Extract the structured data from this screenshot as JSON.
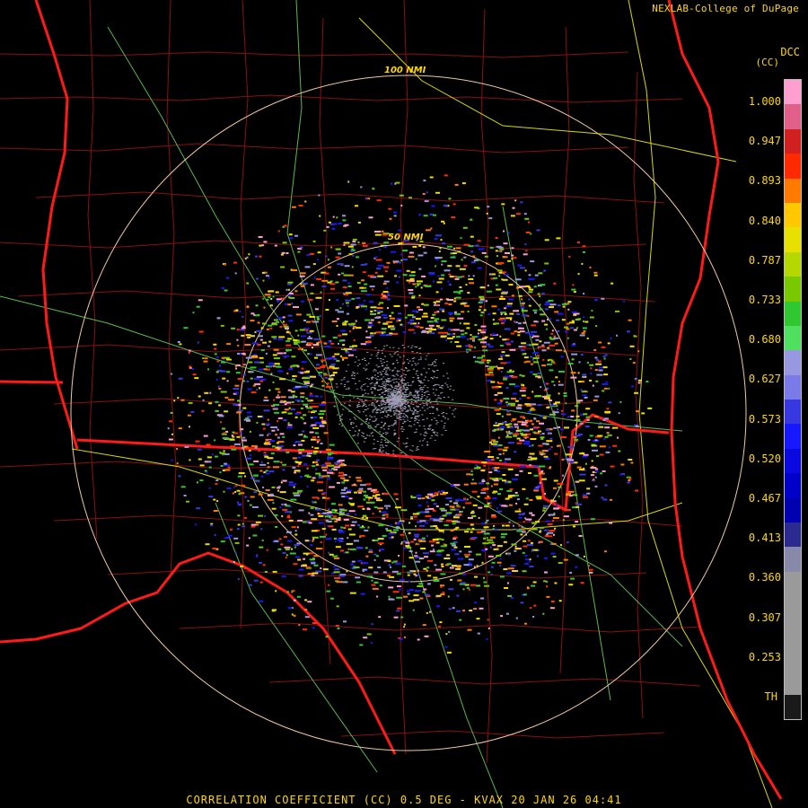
{
  "credit": "NEXLAB-College of DuPage",
  "product_code": "DCC",
  "product_unit": "(CC)",
  "range_rings": [
    {
      "label": "50 NMI"
    },
    {
      "label": "100 NMI"
    }
  ],
  "color_scale": {
    "labels": [
      "1.000",
      "0.947",
      "0.893",
      "0.840",
      "0.787",
      "0.733",
      "0.680",
      "0.627",
      "0.573",
      "0.520",
      "0.467",
      "0.413",
      "0.360",
      "0.307",
      "0.253",
      "TH"
    ],
    "colors": [
      "#ff9fd0",
      "#e0608a",
      "#d02020",
      "#ff2a00",
      "#ff7a00",
      "#ffc800",
      "#e8e000",
      "#b4d800",
      "#7ac800",
      "#30c830",
      "#50e060",
      "#9898e0",
      "#7a7ae8",
      "#3838e0",
      "#1818ff",
      "#0a0ae0",
      "#0000c8",
      "#0000b0",
      "#2a2a90",
      "#8888a8",
      "#9a9a9a",
      "#9a9a9a",
      "#9a9a9a",
      "#9a9a9a",
      "#9a9a9a",
      "#1a1a1a"
    ]
  },
  "footer": "CORRELATION COEFFICIENT (CC) 0.5 DEG - KVAX 20 JAN 26 04:41"
}
